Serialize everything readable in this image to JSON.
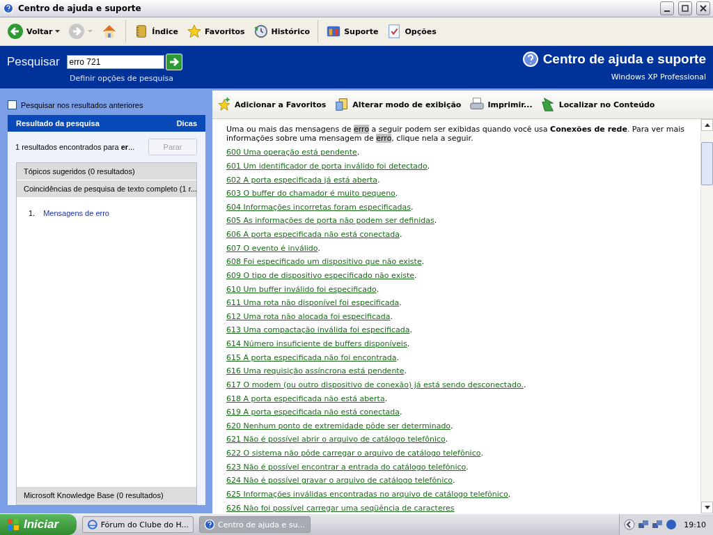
{
  "window": {
    "title": "Centro de ajuda e suporte"
  },
  "toolbar": [
    {
      "kind": "back",
      "label": "Voltar"
    },
    {
      "kind": "forward"
    },
    {
      "kind": "home"
    },
    {
      "kind": "index",
      "label": "Índice"
    },
    {
      "kind": "favorites",
      "label": "Favoritos"
    },
    {
      "kind": "history",
      "label": "Histórico"
    },
    {
      "kind": "support",
      "label": "Suporte"
    },
    {
      "kind": "options",
      "label": "Opções"
    }
  ],
  "header": {
    "search_label": "Pesquisar",
    "search_value": "erro 721",
    "options_link": "Definir opções de pesquisa",
    "title": "Centro de ajuda e suporte",
    "subtitle": "Windows XP Professional"
  },
  "sidebar": {
    "search_previous": {
      "label": "Pesquisar nos resultados anteriores",
      "checked": false
    },
    "panel_title": "Resultado da pesquisa",
    "tips": "Dicas",
    "found": "1 resultados encontrados para **er**...",
    "stop_button": "Parar",
    "groups": [
      {
        "label": "Tópicos sugeridos (0 resultados)"
      },
      {
        "label": "Coincidências de pesquisa de texto completo (1 r..."
      }
    ],
    "results": [
      {
        "number": "1.",
        "label": "Mensagens de erro"
      }
    ],
    "footer_group": "Microsoft Knowledge Base (0 resultados)"
  },
  "content_toolbar": [
    {
      "kind": "add-favorite",
      "label": "Adicionar a Favoritos"
    },
    {
      "kind": "view",
      "label": "Alterar modo de exibição"
    },
    {
      "kind": "print",
      "label": "Imprimir..."
    },
    {
      "kind": "locate",
      "label": "Localizar no Conteúdo"
    }
  ],
  "article": {
    "intro": [
      {
        "kind": "plain",
        "text": "Uma ou mais das mensagens de "
      },
      {
        "kind": "highlight",
        "text": "erro"
      },
      {
        "kind": "plain",
        "text": " a seguir podem ser exibidas quando você usa "
      },
      {
        "kind": "bold",
        "text": "Conexões de rede"
      },
      {
        "kind": "plain",
        "text": ". Para ver mais informações sobre uma mensagem de "
      },
      {
        "kind": "highlight",
        "text": "erro"
      },
      {
        "kind": "plain",
        "text": ", clique nela a seguir."
      }
    ],
    "links": [
      {
        "link": "600 Uma operação está pendente",
        "suffix": "."
      },
      {
        "link": "601 Um identificador de porta inválido foi detectado",
        "suffix": "."
      },
      {
        "link": "602 A porta especificada já está aberta",
        "suffix": "."
      },
      {
        "link": "603 O buffer do chamador é muito pequeno",
        "suffix": "."
      },
      {
        "link": "604 Informações incorretas foram especificadas",
        "suffix": "."
      },
      {
        "link": "605 As informações de porta não podem ser definidas",
        "suffix": "."
      },
      {
        "link": "606 A porta especificada não está conectada",
        "suffix": "."
      },
      {
        "link": "607 O evento é inválido",
        "suffix": "."
      },
      {
        "link": "608 Foi especificado um dispositivo que não existe",
        "suffix": "."
      },
      {
        "link": "609 O tipo de dispositivo especificado não existe",
        "suffix": "."
      },
      {
        "link": "610 Um buffer inválido foi especificado",
        "suffix": "."
      },
      {
        "link": "611 Uma rota não disponível foi especificada",
        "suffix": "."
      },
      {
        "link": "612 Uma rota não alocada foi especificada",
        "suffix": "."
      },
      {
        "link": "613 Uma compactação inválida foi especificada",
        "suffix": "."
      },
      {
        "link": "614 Número insuficiente de buffers disponíveis",
        "suffix": "."
      },
      {
        "link": "615 A porta especificada não foi encontrada",
        "suffix": "."
      },
      {
        "link": "616 Uma requisição assíncrona está pendente",
        "suffix": "."
      },
      {
        "link": "617 O modem (ou outro dispositivo de conexão) já está sendo desconectado.",
        "suffix": "."
      },
      {
        "link": "618 A porta especificada não está aberta",
        "suffix": "."
      },
      {
        "link": "619 A porta especificada não está conectada",
        "suffix": "."
      },
      {
        "link": "620 Nenhum ponto de extremidade pôde ser determinado",
        "suffix": "."
      },
      {
        "link": "621 Não é possível abrir o arquivo de catálogo telefônico",
        "suffix": "."
      },
      {
        "link": "622 O sistema não pôde carregar o arquivo de catálogo telefônico",
        "suffix": "."
      },
      {
        "link": "623 Não é possível encontrar a entrada do catálogo telefônico",
        "suffix": "."
      },
      {
        "link": "624 Não é possível gravar o arquivo de catálogo telefônico",
        "suffix": "."
      },
      {
        "link": "625 Informações inválidas encontradas no arquivo de catálogo telefônico",
        "suffix": "."
      },
      {
        "link": "626 Não foi possível carregar uma seqüência de caracteres"
      }
    ]
  },
  "taskbar": {
    "start": "Iniciar",
    "tasks": [
      {
        "kind": "browser",
        "label": "Fórum do Clube do H...",
        "selected": false
      },
      {
        "kind": "help",
        "label": "Centro de ajuda e su...",
        "selected": true
      }
    ],
    "clock": "19:10"
  }
}
